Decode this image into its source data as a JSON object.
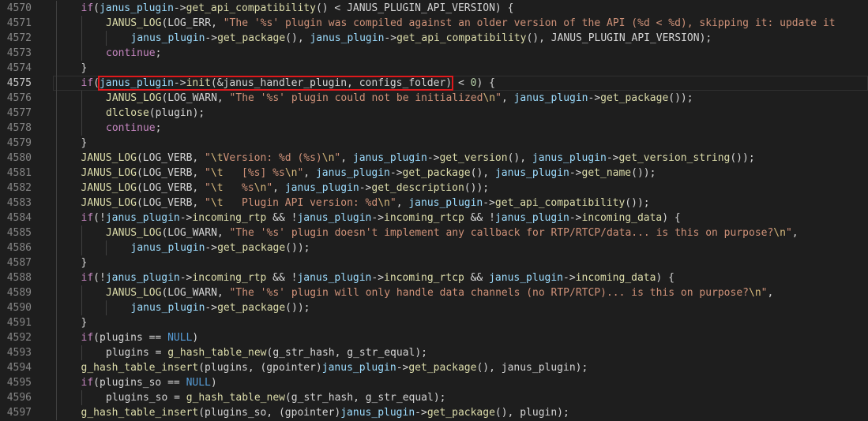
{
  "editor": {
    "highlight_line": 4575,
    "lines": [
      {
        "num": "4570",
        "indent": 1,
        "tokens": [
          {
            "t": "if",
            "c": "kw"
          },
          {
            "t": "(",
            "c": "txt"
          },
          {
            "t": "janus_plugin",
            "c": "var"
          },
          {
            "t": "->",
            "c": "txt"
          },
          {
            "t": "get_api_compatibility",
            "c": "fn"
          },
          {
            "t": "() < JANUS_PLUGIN_API_VERSION) {",
            "c": "txt"
          }
        ]
      },
      {
        "num": "4571",
        "indent": 2,
        "tokens": [
          {
            "t": "JANUS_LOG",
            "c": "mac"
          },
          {
            "t": "(LOG_ERR, ",
            "c": "txt"
          },
          {
            "t": "\"The '%s' plugin was compiled against an older version of the API (%d < %d), skipping it: update it",
            "c": "str"
          }
        ]
      },
      {
        "num": "4572",
        "indent": 3,
        "tokens": [
          {
            "t": "janus_plugin",
            "c": "var"
          },
          {
            "t": "->",
            "c": "txt"
          },
          {
            "t": "get_package",
            "c": "fn"
          },
          {
            "t": "(), ",
            "c": "txt"
          },
          {
            "t": "janus_plugin",
            "c": "var"
          },
          {
            "t": "->",
            "c": "txt"
          },
          {
            "t": "get_api_compatibility",
            "c": "fn"
          },
          {
            "t": "(), JANUS_PLUGIN_API_VERSION);",
            "c": "txt"
          }
        ]
      },
      {
        "num": "4573",
        "indent": 2,
        "tokens": [
          {
            "t": "continue",
            "c": "kw"
          },
          {
            "t": ";",
            "c": "txt"
          }
        ]
      },
      {
        "num": "4574",
        "indent": 1,
        "tokens": [
          {
            "t": "}",
            "c": "txt"
          }
        ]
      },
      {
        "num": "4575",
        "indent": 1,
        "tokens": [
          {
            "t": "if",
            "c": "kw"
          },
          {
            "t": "(",
            "c": "txt"
          },
          {
            "t": "janus_plugin",
            "c": "var",
            "hl": "start"
          },
          {
            "t": "->",
            "c": "txt"
          },
          {
            "t": "init",
            "c": "fn"
          },
          {
            "t": "(&janus_handler_plugin, configs_folder)",
            "c": "txt",
            "hl": "end"
          },
          {
            "t": " < ",
            "c": "txt"
          },
          {
            "t": "0",
            "c": "num"
          },
          {
            "t": ") {",
            "c": "txt"
          }
        ]
      },
      {
        "num": "4576",
        "indent": 2,
        "tokens": [
          {
            "t": "JANUS_LOG",
            "c": "mac"
          },
          {
            "t": "(LOG_WARN, ",
            "c": "txt"
          },
          {
            "t": "\"The '%s' plugin could not be initialized",
            "c": "str"
          },
          {
            "t": "\\n",
            "c": "esc"
          },
          {
            "t": "\"",
            "c": "str"
          },
          {
            "t": ", ",
            "c": "txt"
          },
          {
            "t": "janus_plugin",
            "c": "var"
          },
          {
            "t": "->",
            "c": "txt"
          },
          {
            "t": "get_package",
            "c": "fn"
          },
          {
            "t": "());",
            "c": "txt"
          }
        ]
      },
      {
        "num": "4577",
        "indent": 2,
        "tokens": [
          {
            "t": "dlclose",
            "c": "fn"
          },
          {
            "t": "(plugin);",
            "c": "txt"
          }
        ]
      },
      {
        "num": "4578",
        "indent": 2,
        "tokens": [
          {
            "t": "continue",
            "c": "kw"
          },
          {
            "t": ";",
            "c": "txt"
          }
        ]
      },
      {
        "num": "4579",
        "indent": 1,
        "tokens": [
          {
            "t": "}",
            "c": "txt"
          }
        ]
      },
      {
        "num": "4580",
        "indent": 1,
        "tokens": [
          {
            "t": "JANUS_LOG",
            "c": "mac"
          },
          {
            "t": "(LOG_VERB, ",
            "c": "txt"
          },
          {
            "t": "\"",
            "c": "str"
          },
          {
            "t": "\\t",
            "c": "esc"
          },
          {
            "t": "Version: %d (%s)",
            "c": "str"
          },
          {
            "t": "\\n",
            "c": "esc"
          },
          {
            "t": "\"",
            "c": "str"
          },
          {
            "t": ", ",
            "c": "txt"
          },
          {
            "t": "janus_plugin",
            "c": "var"
          },
          {
            "t": "->",
            "c": "txt"
          },
          {
            "t": "get_version",
            "c": "fn"
          },
          {
            "t": "(), ",
            "c": "txt"
          },
          {
            "t": "janus_plugin",
            "c": "var"
          },
          {
            "t": "->",
            "c": "txt"
          },
          {
            "t": "get_version_string",
            "c": "fn"
          },
          {
            "t": "());",
            "c": "txt"
          }
        ]
      },
      {
        "num": "4581",
        "indent": 1,
        "tokens": [
          {
            "t": "JANUS_LOG",
            "c": "mac"
          },
          {
            "t": "(LOG_VERB, ",
            "c": "txt"
          },
          {
            "t": "\"",
            "c": "str"
          },
          {
            "t": "\\t",
            "c": "esc"
          },
          {
            "t": "   [%s] %s",
            "c": "str"
          },
          {
            "t": "\\n",
            "c": "esc"
          },
          {
            "t": "\"",
            "c": "str"
          },
          {
            "t": ", ",
            "c": "txt"
          },
          {
            "t": "janus_plugin",
            "c": "var"
          },
          {
            "t": "->",
            "c": "txt"
          },
          {
            "t": "get_package",
            "c": "fn"
          },
          {
            "t": "(), ",
            "c": "txt"
          },
          {
            "t": "janus_plugin",
            "c": "var"
          },
          {
            "t": "->",
            "c": "txt"
          },
          {
            "t": "get_name",
            "c": "fn"
          },
          {
            "t": "());",
            "c": "txt"
          }
        ]
      },
      {
        "num": "4582",
        "indent": 1,
        "tokens": [
          {
            "t": "JANUS_LOG",
            "c": "mac"
          },
          {
            "t": "(LOG_VERB, ",
            "c": "txt"
          },
          {
            "t": "\"",
            "c": "str"
          },
          {
            "t": "\\t",
            "c": "esc"
          },
          {
            "t": "   %s",
            "c": "str"
          },
          {
            "t": "\\n",
            "c": "esc"
          },
          {
            "t": "\"",
            "c": "str"
          },
          {
            "t": ", ",
            "c": "txt"
          },
          {
            "t": "janus_plugin",
            "c": "var"
          },
          {
            "t": "->",
            "c": "txt"
          },
          {
            "t": "get_description",
            "c": "fn"
          },
          {
            "t": "());",
            "c": "txt"
          }
        ]
      },
      {
        "num": "4583",
        "indent": 1,
        "tokens": [
          {
            "t": "JANUS_LOG",
            "c": "mac"
          },
          {
            "t": "(LOG_VERB, ",
            "c": "txt"
          },
          {
            "t": "\"",
            "c": "str"
          },
          {
            "t": "\\t",
            "c": "esc"
          },
          {
            "t": "   Plugin API version: %d",
            "c": "str"
          },
          {
            "t": "\\n",
            "c": "esc"
          },
          {
            "t": "\"",
            "c": "str"
          },
          {
            "t": ", ",
            "c": "txt"
          },
          {
            "t": "janus_plugin",
            "c": "var"
          },
          {
            "t": "->",
            "c": "txt"
          },
          {
            "t": "get_api_compatibility",
            "c": "fn"
          },
          {
            "t": "());",
            "c": "txt"
          }
        ]
      },
      {
        "num": "4584",
        "indent": 1,
        "tokens": [
          {
            "t": "if",
            "c": "kw"
          },
          {
            "t": "(!",
            "c": "txt"
          },
          {
            "t": "janus_plugin",
            "c": "var"
          },
          {
            "t": "->",
            "c": "txt"
          },
          {
            "t": "incoming_rtp",
            "c": "fn"
          },
          {
            "t": " && !",
            "c": "txt"
          },
          {
            "t": "janus_plugin",
            "c": "var"
          },
          {
            "t": "->",
            "c": "txt"
          },
          {
            "t": "incoming_rtcp",
            "c": "fn"
          },
          {
            "t": " && !",
            "c": "txt"
          },
          {
            "t": "janus_plugin",
            "c": "var"
          },
          {
            "t": "->",
            "c": "txt"
          },
          {
            "t": "incoming_data",
            "c": "fn"
          },
          {
            "t": ") {",
            "c": "txt"
          }
        ]
      },
      {
        "num": "4585",
        "indent": 2,
        "tokens": [
          {
            "t": "JANUS_LOG",
            "c": "mac"
          },
          {
            "t": "(LOG_WARN, ",
            "c": "txt"
          },
          {
            "t": "\"The '%s' plugin doesn't implement any callback for RTP/RTCP/data... is this on purpose?",
            "c": "str"
          },
          {
            "t": "\\n",
            "c": "esc"
          },
          {
            "t": "\"",
            "c": "str"
          },
          {
            "t": ",",
            "c": "txt"
          }
        ]
      },
      {
        "num": "4586",
        "indent": 3,
        "tokens": [
          {
            "t": "janus_plugin",
            "c": "var"
          },
          {
            "t": "->",
            "c": "txt"
          },
          {
            "t": "get_package",
            "c": "fn"
          },
          {
            "t": "());",
            "c": "txt"
          }
        ]
      },
      {
        "num": "4587",
        "indent": 1,
        "tokens": [
          {
            "t": "}",
            "c": "txt"
          }
        ]
      },
      {
        "num": "4588",
        "indent": 1,
        "tokens": [
          {
            "t": "if",
            "c": "kw"
          },
          {
            "t": "(!",
            "c": "txt"
          },
          {
            "t": "janus_plugin",
            "c": "var"
          },
          {
            "t": "->",
            "c": "txt"
          },
          {
            "t": "incoming_rtp",
            "c": "fn"
          },
          {
            "t": " && !",
            "c": "txt"
          },
          {
            "t": "janus_plugin",
            "c": "var"
          },
          {
            "t": "->",
            "c": "txt"
          },
          {
            "t": "incoming_rtcp",
            "c": "fn"
          },
          {
            "t": " && ",
            "c": "txt"
          },
          {
            "t": "janus_plugin",
            "c": "var"
          },
          {
            "t": "->",
            "c": "txt"
          },
          {
            "t": "incoming_data",
            "c": "fn"
          },
          {
            "t": ") {",
            "c": "txt"
          }
        ]
      },
      {
        "num": "4589",
        "indent": 2,
        "tokens": [
          {
            "t": "JANUS_LOG",
            "c": "mac"
          },
          {
            "t": "(LOG_WARN, ",
            "c": "txt"
          },
          {
            "t": "\"The '%s' plugin will only handle data channels (no RTP/RTCP)... is this on purpose?",
            "c": "str"
          },
          {
            "t": "\\n",
            "c": "esc"
          },
          {
            "t": "\"",
            "c": "str"
          },
          {
            "t": ",",
            "c": "txt"
          }
        ]
      },
      {
        "num": "4590",
        "indent": 3,
        "tokens": [
          {
            "t": "janus_plugin",
            "c": "var"
          },
          {
            "t": "->",
            "c": "txt"
          },
          {
            "t": "get_package",
            "c": "fn"
          },
          {
            "t": "());",
            "c": "txt"
          }
        ]
      },
      {
        "num": "4591",
        "indent": 1,
        "tokens": [
          {
            "t": "}",
            "c": "txt"
          }
        ]
      },
      {
        "num": "4592",
        "indent": 1,
        "tokens": [
          {
            "t": "if",
            "c": "kw"
          },
          {
            "t": "(plugins == ",
            "c": "txt"
          },
          {
            "t": "NULL",
            "c": "nul"
          },
          {
            "t": ")",
            "c": "txt"
          }
        ]
      },
      {
        "num": "4593",
        "indent": 2,
        "tokens": [
          {
            "t": "plugins = ",
            "c": "txt"
          },
          {
            "t": "g_hash_table_new",
            "c": "fn"
          },
          {
            "t": "(g_str_hash, g_str_equal);",
            "c": "txt"
          }
        ]
      },
      {
        "num": "4594",
        "indent": 1,
        "tokens": [
          {
            "t": "g_hash_table_insert",
            "c": "fn"
          },
          {
            "t": "(plugins, (gpointer)",
            "c": "txt"
          },
          {
            "t": "janus_plugin",
            "c": "var"
          },
          {
            "t": "->",
            "c": "txt"
          },
          {
            "t": "get_package",
            "c": "fn"
          },
          {
            "t": "(), janus_plugin);",
            "c": "txt"
          }
        ]
      },
      {
        "num": "4595",
        "indent": 1,
        "tokens": [
          {
            "t": "if",
            "c": "kw"
          },
          {
            "t": "(plugins_so == ",
            "c": "txt"
          },
          {
            "t": "NULL",
            "c": "nul"
          },
          {
            "t": ")",
            "c": "txt"
          }
        ]
      },
      {
        "num": "4596",
        "indent": 2,
        "tokens": [
          {
            "t": "plugins_so = ",
            "c": "txt"
          },
          {
            "t": "g_hash_table_new",
            "c": "fn"
          },
          {
            "t": "(g_str_hash, g_str_equal);",
            "c": "txt"
          }
        ]
      },
      {
        "num": "4597",
        "indent": 1,
        "tokens": [
          {
            "t": "g_hash_table_insert",
            "c": "fn"
          },
          {
            "t": "(plugins_so, (gpointer)",
            "c": "txt"
          },
          {
            "t": "janus_plugin",
            "c": "var"
          },
          {
            "t": "->",
            "c": "txt"
          },
          {
            "t": "get_package",
            "c": "fn"
          },
          {
            "t": "(), plugin);",
            "c": "txt"
          }
        ]
      }
    ]
  }
}
